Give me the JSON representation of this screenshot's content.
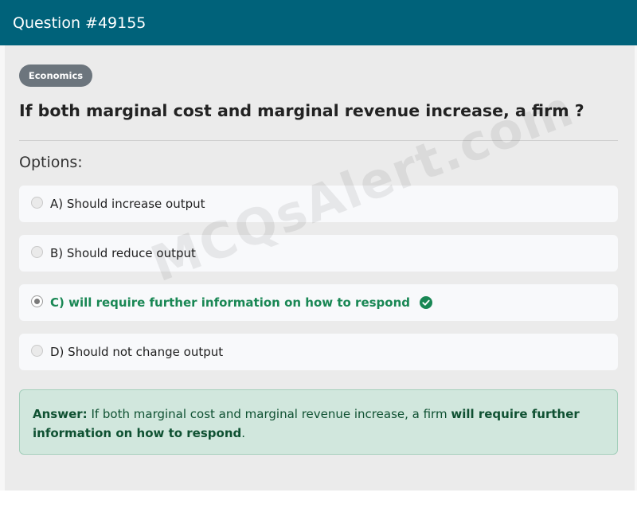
{
  "header": {
    "title": "Question #49155"
  },
  "category_badge": "Economics",
  "question": "If both marginal cost and marginal revenue increase, a firm ?",
  "options_label": "Options:",
  "options": [
    {
      "label": "A) Should increase output",
      "selected": false,
      "correct": false
    },
    {
      "label": "B) Should reduce output",
      "selected": false,
      "correct": false
    },
    {
      "label": "C) will require further information on how to respond",
      "selected": true,
      "correct": true
    },
    {
      "label": "D) Should not change output",
      "selected": false,
      "correct": false
    }
  ],
  "answer": {
    "prefix": "Answer:",
    "text": "If both marginal cost and marginal revenue increase, a firm",
    "highlight": "will require further information on how to respond",
    "suffix": "."
  },
  "watermark": "MCQsAlert.com",
  "colors": {
    "header_bg": "#00627a",
    "correct": "#198754",
    "answer_bg": "#d1e7dd"
  },
  "icons": {
    "correct_marker": "check-circle-icon"
  }
}
